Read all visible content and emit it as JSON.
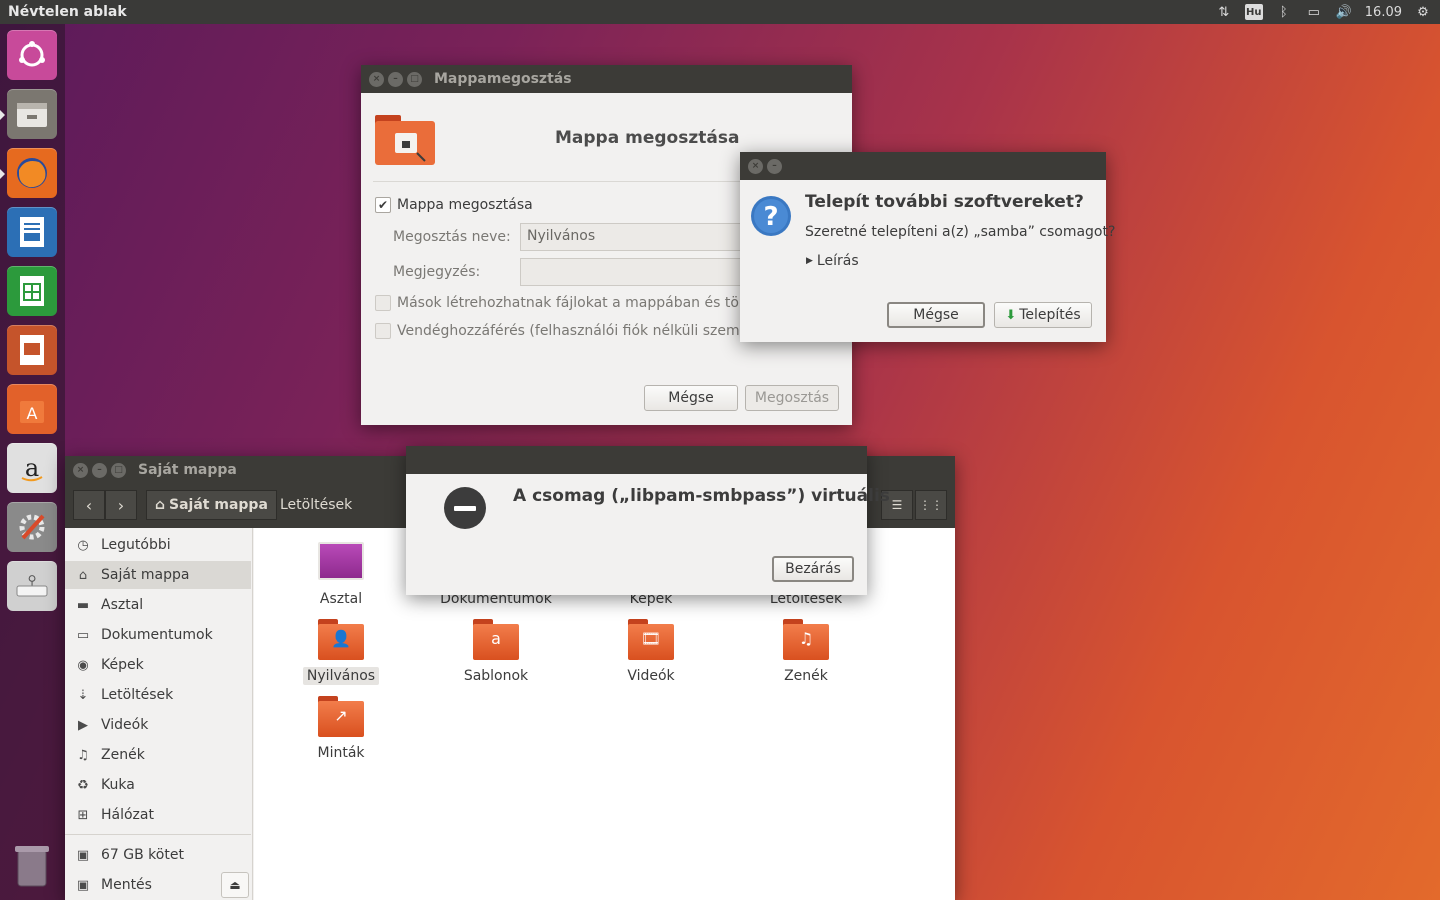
{
  "top_panel": {
    "title": "Névtelen ablak",
    "keyboard": "Hu",
    "time": "16.09"
  },
  "launcher": [
    {
      "name": "ubuntu-dash-icon",
      "color": "#c84a9a"
    },
    {
      "name": "files-icon",
      "color": "#7b7770"
    },
    {
      "name": "firefox-icon",
      "color": "#e66a1f"
    },
    {
      "name": "writer-icon",
      "color": "#2c6fb5"
    },
    {
      "name": "calc-icon",
      "color": "#2c9a3c"
    },
    {
      "name": "impress-icon",
      "color": "#c5542b"
    },
    {
      "name": "software-center-icon",
      "color": "#e2612a"
    },
    {
      "name": "amazon-icon",
      "color": "#d8d8d8"
    },
    {
      "name": "system-settings-icon",
      "color": "#8a8a8a"
    },
    {
      "name": "usb-installer-icon",
      "color": "#d0d0d0"
    },
    {
      "name": "trash-icon",
      "color": "#6a5a6a"
    }
  ],
  "share_window": {
    "title": "Mappamegosztás",
    "header": "Mappa megosztása",
    "share_checkbox": "Mappa megosztása",
    "share_name_label": "Megosztás neve:",
    "share_name_value": "Nyilvános",
    "comment_label": "Megjegyzés:",
    "comment_value": "",
    "others_create": "Mások létrehozhatnak fájlokat a mappában és törö",
    "guest_access": "Vendéghozzáférés (felhasználói fiók nélküli szemé",
    "cancel": "Mégse",
    "share": "Megosztás"
  },
  "install_dialog": {
    "title": "Telepít további szoftvereket?",
    "question": "Szeretné telepíteni a(z) „samba” csomagot?",
    "details": "Leírás",
    "cancel": "Mégse",
    "install": "Telepítés"
  },
  "file_manager": {
    "title": "Saját mappa",
    "crumb_home": "Saját mappa",
    "crumb_downloads": "Letöltések",
    "sidebar": [
      {
        "label": "Legutóbbi",
        "icon": "◷"
      },
      {
        "label": "Saját mappa",
        "icon": "⌂"
      },
      {
        "label": "Asztal",
        "icon": "▬"
      },
      {
        "label": "Dokumentumok",
        "icon": "▭"
      },
      {
        "label": "Képek",
        "icon": "◉"
      },
      {
        "label": "Letöltések",
        "icon": "⇣"
      },
      {
        "label": "Videók",
        "icon": "▶"
      },
      {
        "label": "Zenék",
        "icon": "♫"
      },
      {
        "label": "Kuka",
        "icon": "♻"
      },
      {
        "label": "Hálózat",
        "icon": "⊞"
      }
    ],
    "devices": [
      {
        "label": "67 GB kötet",
        "icon": "▣"
      },
      {
        "label": "Mentés",
        "icon": "▣"
      }
    ],
    "folders": [
      {
        "label": "Asztal",
        "symbol": ""
      },
      {
        "label": "Dokumentumok",
        "symbol": ""
      },
      {
        "label": "Képek",
        "symbol": ""
      },
      {
        "label": "Letöltések",
        "symbol": ""
      },
      {
        "label": "Nyilvános",
        "symbol": "👤"
      },
      {
        "label": "Sablonok",
        "symbol": "a"
      },
      {
        "label": "Videók",
        "symbol": "🎞"
      },
      {
        "label": "Zenék",
        "symbol": "♫"
      },
      {
        "label": "Minták",
        "symbol": "↗"
      }
    ]
  },
  "error_dialog": {
    "message": "A csomag („libpam-smbpass”) virtuális",
    "close": "Bezárás"
  }
}
